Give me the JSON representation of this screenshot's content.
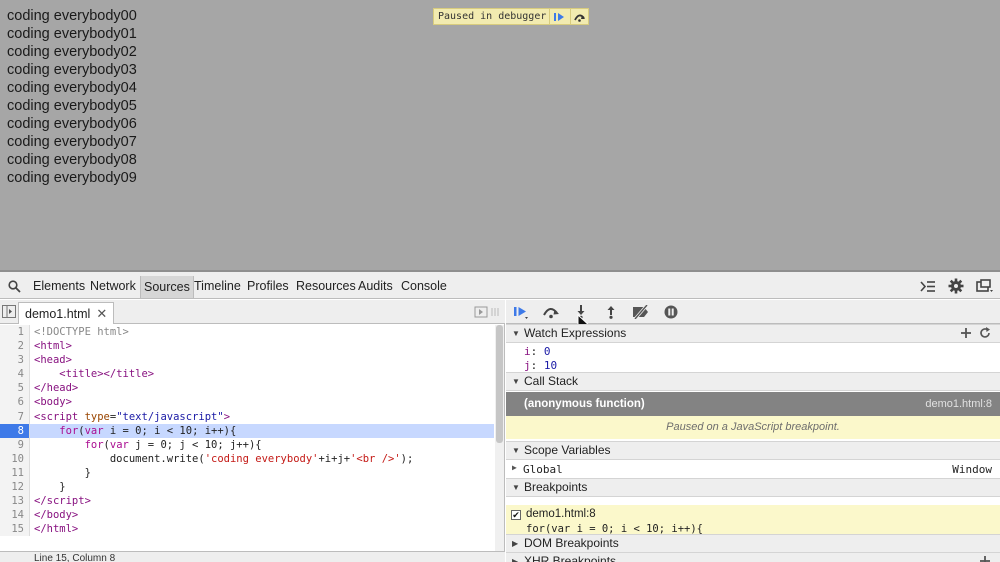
{
  "page": {
    "lines": [
      "coding everybody00",
      "coding everybody01",
      "coding everybody02",
      "coding everybody03",
      "coding everybody04",
      "coding everybody05",
      "coding everybody06",
      "coding everybody07",
      "coding everybody08",
      "coding everybody09"
    ],
    "paused_text": "Paused in debugger"
  },
  "devtools": {
    "tabs": {
      "elements": "Elements",
      "network": "Network",
      "sources": "Sources",
      "timeline": "Timeline",
      "profiles": "Profiles",
      "resources": "Resources",
      "audits": "Audits",
      "console": "Console"
    },
    "active_tab": "Sources",
    "file_tab": "demo1.html",
    "file_tab_close": "✕",
    "status": "Line 15, Column 8",
    "code": {
      "line_numbers": [
        "1",
        "2",
        "3",
        "4",
        "5",
        "6",
        "7",
        "8",
        "9",
        "10",
        "11",
        "12",
        "13",
        "14",
        "15"
      ],
      "highlight_line": 8
    }
  },
  "debugger": {
    "watch": {
      "title": "Watch Expressions",
      "items": [
        {
          "name": "i",
          "value": "0"
        },
        {
          "name": "j",
          "value": "10"
        }
      ]
    },
    "call_stack": {
      "title": "Call Stack",
      "frame": "(anonymous function)",
      "location": "demo1.html:8",
      "paused_message": "Paused on a JavaScript breakpoint."
    },
    "scope": {
      "title": "Scope Variables",
      "global_label": "Global",
      "global_value": "Window"
    },
    "breakpoints": {
      "title": "Breakpoints",
      "checked": true,
      "location": "demo1.html:8",
      "code": "for(var i = 0; i < 10; i++){"
    },
    "dom_breakpoints": "DOM Breakpoints",
    "xhr_breakpoints": "XHR Breakpoints"
  },
  "colors": {
    "highlight_line": "#3e7ae8",
    "paused_banner": "#fbf8cb",
    "call_frame": "#838383"
  }
}
